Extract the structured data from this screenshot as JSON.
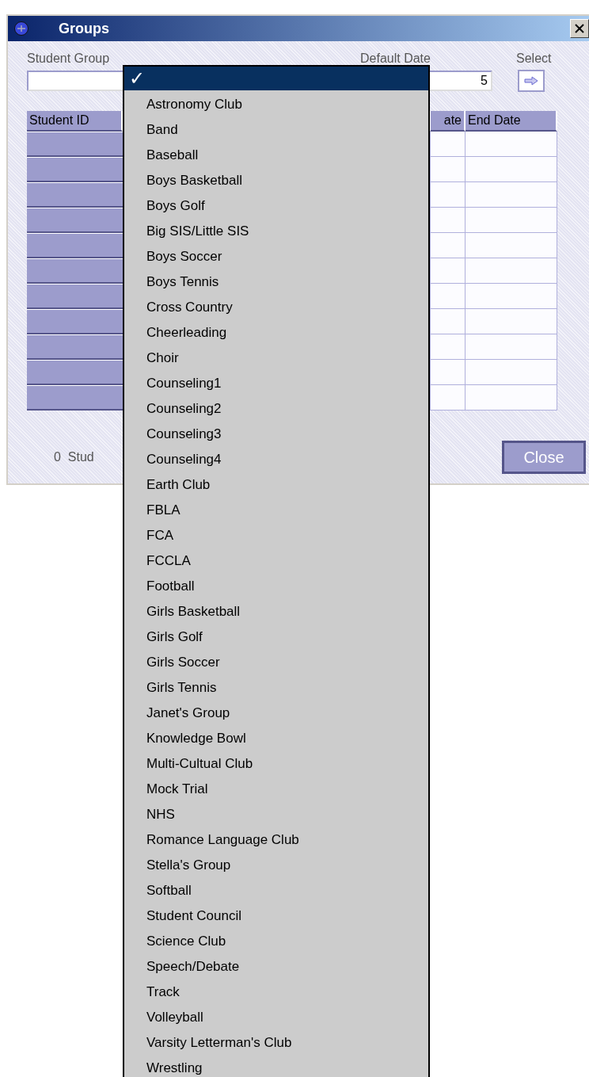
{
  "window": {
    "title": "Groups"
  },
  "form": {
    "group_label": "Student Group",
    "date_label": "Default Date",
    "date_value": "5",
    "select_label": "Select"
  },
  "table": {
    "columns": [
      {
        "label": "Student ID"
      },
      {
        "label": "ate"
      },
      {
        "label": "End Date"
      }
    ],
    "rows": [
      {
        "kind": "blank"
      },
      {
        "kind": "blank"
      },
      {
        "kind": "blank"
      },
      {
        "kind": "blank"
      },
      {
        "kind": "blank"
      },
      {
        "kind": "blank"
      },
      {
        "kind": "blank"
      },
      {
        "kind": "blank"
      },
      {
        "kind": "blank"
      },
      {
        "kind": "blank"
      },
      {
        "kind": "blank"
      }
    ]
  },
  "footer": {
    "count": "0",
    "count_label": "Stud",
    "close_button": "Close"
  },
  "dropdown": {
    "items": [
      {
        "check": "✓",
        "selected": true
      },
      {
        "label": "Astronomy Club",
        "selected": false
      },
      {
        "label": "Band",
        "selected": false
      },
      {
        "label": "Baseball",
        "selected": false
      },
      {
        "label": "Boys Basketball",
        "selected": false
      },
      {
        "label": "Boys Golf",
        "selected": false
      },
      {
        "label": "Big SIS/Little SIS",
        "selected": false
      },
      {
        "label": "Boys Soccer",
        "selected": false
      },
      {
        "label": "Boys Tennis",
        "selected": false
      },
      {
        "label": "Cross Country",
        "selected": false
      },
      {
        "label": "Cheerleading",
        "selected": false
      },
      {
        "label": "Choir",
        "selected": false
      },
      {
        "label": "Counseling1",
        "selected": false
      },
      {
        "label": "Counseling2",
        "selected": false
      },
      {
        "label": "Counseling3",
        "selected": false
      },
      {
        "label": "Counseling4",
        "selected": false
      },
      {
        "label": "Earth Club",
        "selected": false
      },
      {
        "label": "FBLA",
        "selected": false
      },
      {
        "label": "FCA",
        "selected": false
      },
      {
        "label": "FCCLA",
        "selected": false
      },
      {
        "label": "Football",
        "selected": false
      },
      {
        "label": "Girls Basketball",
        "selected": false
      },
      {
        "label": "Girls Golf",
        "selected": false
      },
      {
        "label": "Girls Soccer",
        "selected": false
      },
      {
        "label": "Girls Tennis",
        "selected": false
      },
      {
        "label": "Janet's Group",
        "selected": false
      },
      {
        "label": "Knowledge Bowl",
        "selected": false
      },
      {
        "label": "Multi-Cultual Club",
        "selected": false
      },
      {
        "label": "Mock Trial",
        "selected": false
      },
      {
        "label": "NHS",
        "selected": false
      },
      {
        "label": "Romance Language Club",
        "selected": false
      },
      {
        "label": "Stella's Group",
        "selected": false
      },
      {
        "label": "Softball",
        "selected": false
      },
      {
        "label": "Student Council",
        "selected": false
      },
      {
        "label": "Science Club",
        "selected": false
      },
      {
        "label": "Speech/Debate",
        "selected": false
      },
      {
        "label": "Track",
        "selected": false
      },
      {
        "label": "Volleyball",
        "selected": false
      },
      {
        "label": "Varsity Letterman's Club",
        "selected": false
      },
      {
        "label": "Wrestling",
        "selected": false
      }
    ]
  }
}
